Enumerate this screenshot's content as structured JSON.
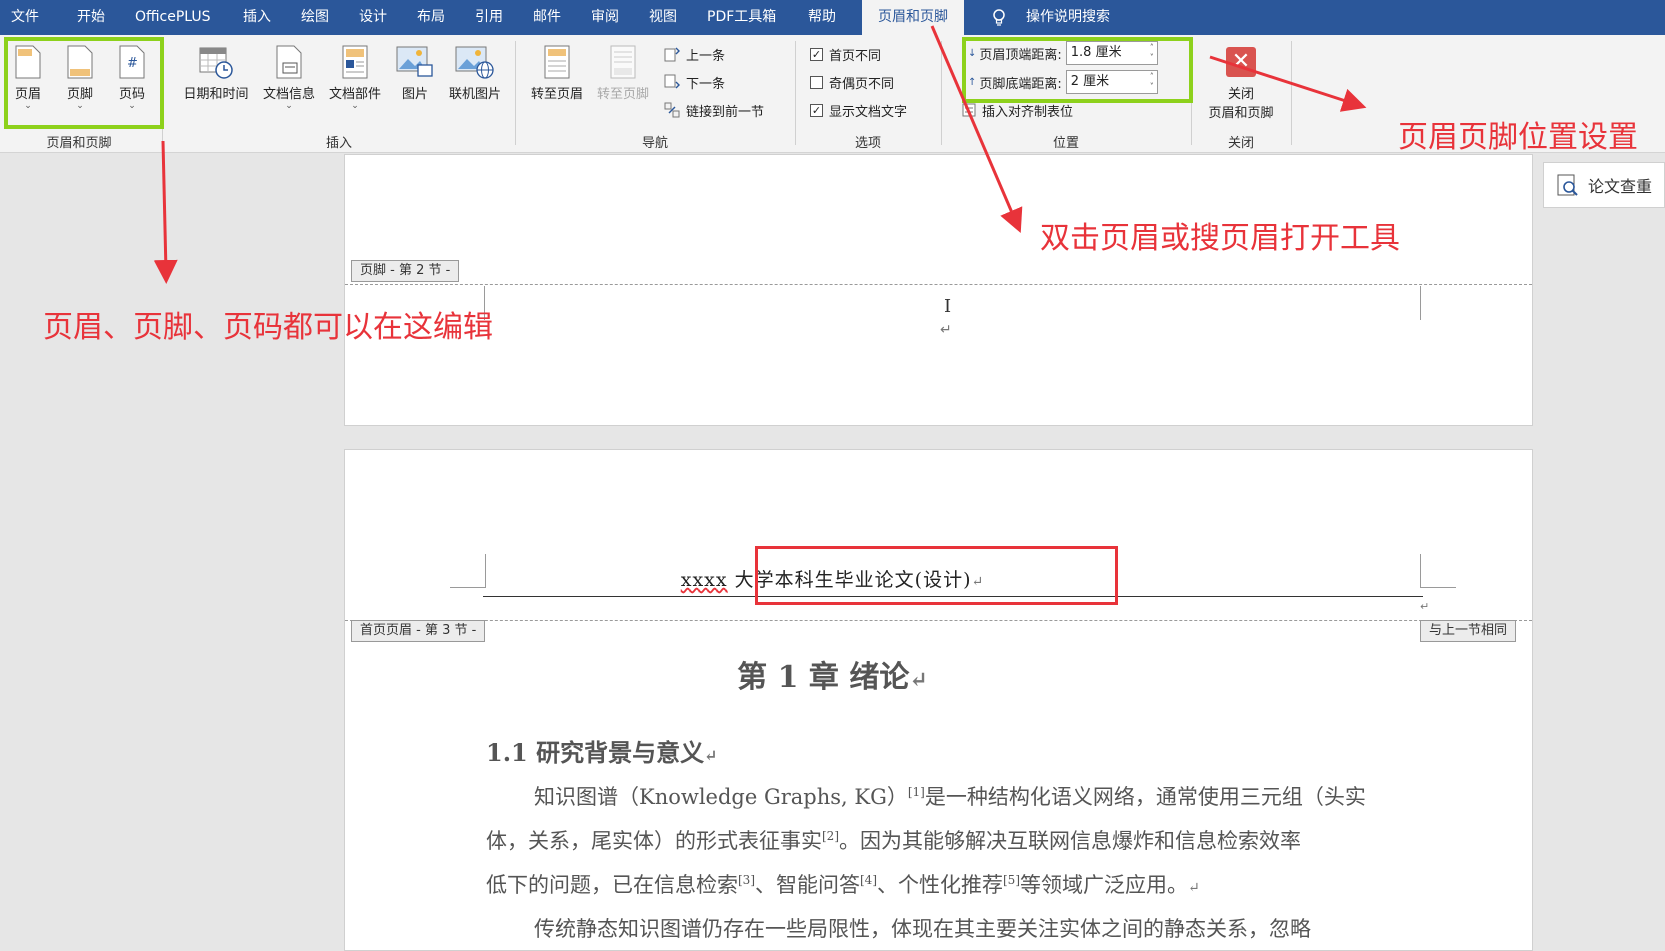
{
  "menubar": {
    "tabs": [
      {
        "label": "文件",
        "active": false
      },
      {
        "label": "开始",
        "active": false
      },
      {
        "label": "OfficePLUS",
        "active": false
      },
      {
        "label": "插入",
        "active": false
      },
      {
        "label": "绘图",
        "active": false
      },
      {
        "label": "设计",
        "active": false
      },
      {
        "label": "布局",
        "active": false
      },
      {
        "label": "引用",
        "active": false
      },
      {
        "label": "邮件",
        "active": false
      },
      {
        "label": "审阅",
        "active": false
      },
      {
        "label": "视图",
        "active": false
      },
      {
        "label": "PDF工具箱",
        "active": false
      },
      {
        "label": "帮助",
        "active": false
      },
      {
        "label": "页眉和页脚",
        "active": true
      }
    ],
    "search_label": "操作说明搜索",
    "colors": {
      "bar": "#2b579a",
      "ribbon": "#f3f3f3"
    }
  },
  "ribbon": {
    "groups": {
      "header_footer": {
        "label": "页眉和页脚",
        "header": "页眉",
        "footer": "页脚",
        "page_number": "页码"
      },
      "insert": {
        "label": "插入",
        "date_time": "日期和时间",
        "doc_info": "文档信息",
        "doc_parts": "文档部件",
        "picture": "图片",
        "online_picture": "联机图片"
      },
      "navigation": {
        "label": "导航",
        "goto_header": "转至页眉",
        "goto_footer": "转至页脚",
        "previous": "上一条",
        "next": "下一条",
        "link_previous": "链接到前一节"
      },
      "options": {
        "label": "选项",
        "different_first_page": {
          "label": "首页不同",
          "checked": true
        },
        "different_odd_even": {
          "label": "奇偶页不同",
          "checked": false
        },
        "show_document_text": {
          "label": "显示文档文字",
          "checked": true
        }
      },
      "position": {
        "label": "位置",
        "header_top_label": "页眉顶端距离:",
        "header_top_value": "1.8 厘米",
        "footer_bottom_label": "页脚底端距离:",
        "footer_bottom_value": "2 厘米",
        "insert_align_tab": "插入对齐制表位"
      },
      "close": {
        "label": "关闭",
        "close_line1": "关闭",
        "close_line2": "页眉和页脚"
      }
    }
  },
  "document": {
    "footer_tag": "页脚 - 第 2 节 -",
    "first_page_header_tag": "首页页眉 - 第 3 节 -",
    "same_as_previous_tag": "与上一节相同",
    "header_text_prefix": "xxxx",
    "header_text_rest": " 大学本科生毕业论文(设计)",
    "chapter_title": "第 1 章  绪论",
    "section_title": "1.1  研究背景与意义",
    "paragraph_lines": [
      {
        "parts": [
          "知识图谱（Knowledge Graphs, KG）",
          "[1]",
          "是一种结构化语义网络，通常使用三元组（头实"
        ]
      },
      {
        "parts": [
          "体，关系，尾实体）的形式表征事实",
          "[2]",
          "。因为其能够解决互联网信息爆炸和信息检索效率"
        ]
      },
      {
        "parts": [
          "低下的问题，已在信息检索",
          "[3]",
          "、智能问答",
          "[4]",
          "、个性化推荐",
          "[5]",
          "等领域广泛应用。"
        ]
      },
      {
        "parts": [
          "传统静态知识图谱仍存在一些局限性，体现在其主要关注实体之间的静态关系，忽略"
        ]
      }
    ],
    "para_mark": "↵"
  },
  "side_panel": {
    "label": "论文查重"
  },
  "annotations": {
    "edit_here": "页眉、页脚、页码都可以在这编辑",
    "double_click": "双击页眉或搜页眉打开工具",
    "position_settings": "页眉页脚位置设置",
    "color": "#e8333a",
    "highlight_color": "#8dd11b"
  }
}
